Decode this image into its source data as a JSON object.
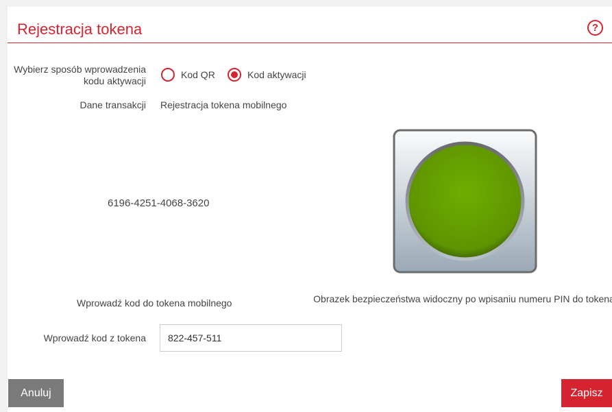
{
  "header": {
    "title": "Rejestracja tokena",
    "help_icon_label": "?"
  },
  "form": {
    "method_label": "Wybierz sposób wprowadzenia kodu aktywacji",
    "method_options": [
      {
        "label": "Kod QR",
        "selected": false
      },
      {
        "label": "Kod aktywacji",
        "selected": true
      }
    ],
    "transaction_label": "Dane transakcji",
    "transaction_value": "Rejestracja tokena mobilnego",
    "activation_code": "6196-4251-4068-3620",
    "enter_to_token_label": "Wprowadź kod do tokena mobilnego",
    "security_image_caption": "Obrazek bezpieczeństwa widoczny po wpisaniu numeru PIN do tokena",
    "token_code_label": "Wprowadź kod z tokena",
    "token_code_value": "822-457-511"
  },
  "actions": {
    "cancel_label": "Anuluj",
    "save_label": "Zapisz"
  },
  "colors": {
    "accent": "#d5232f",
    "security_circle": "#66a000",
    "cancel_bg": "#7a7a7a"
  },
  "icons": {
    "help": "help-icon",
    "security_image": "green-circle-button"
  }
}
